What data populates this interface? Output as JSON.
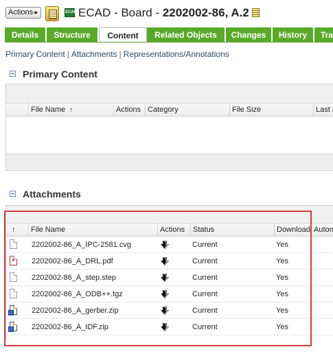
{
  "header": {
    "actions_label": "Actions",
    "ecad_badge": "ECAD",
    "title_prefix": "ECAD - Board - ",
    "title_number": "2202002-86, A.2"
  },
  "tabs": [
    {
      "label": "Details",
      "active": false
    },
    {
      "label": "Structure",
      "active": false
    },
    {
      "label": "Content",
      "active": true
    },
    {
      "label": "Related Objects",
      "active": false
    },
    {
      "label": "Changes",
      "active": false
    },
    {
      "label": "History",
      "active": false
    },
    {
      "label": "Tra",
      "active": false
    }
  ],
  "subnav": {
    "primary": "Primary Content",
    "attachments": "Attachments",
    "representations": "Representations/Annotations"
  },
  "primary_content": {
    "title": "Primary Content",
    "columns": [
      "File Name",
      "Actions",
      "Category",
      "File Size",
      "Last M"
    ],
    "sort_arrow": "↑"
  },
  "attachments": {
    "title": "Attachments",
    "sort_arrow": "↑",
    "columns": [
      "File Name",
      "Actions",
      "Status",
      "Download",
      "Autom"
    ],
    "rows": [
      {
        "icon": "generic-file-icon",
        "file_name": "2202002-86_A_IPC-2581.cvg",
        "status": "Current",
        "download": "Yes"
      },
      {
        "icon": "pdf-file-icon",
        "file_name": "2202002-86_A_DRL.pdf",
        "status": "Current",
        "download": "Yes"
      },
      {
        "icon": "generic-file-icon",
        "file_name": "2202002-86_A_step.step",
        "status": "Current",
        "download": "Yes"
      },
      {
        "icon": "generic-file-icon",
        "file_name": "2202002-86_A_ODB++.tgz",
        "status": "Current",
        "download": "Yes"
      },
      {
        "icon": "zip-file-icon",
        "file_name": "2202002-86_A_gerber.zip",
        "status": "Current",
        "download": "Yes"
      },
      {
        "icon": "zip-file-icon",
        "file_name": "2202002-86_A_IDF.zip",
        "status": "Current",
        "download": "Yes"
      }
    ]
  },
  "colors": {
    "tab_green": "#5aaa2a",
    "highlight_red": "#d83a3a",
    "link_blue": "#2a4a6a"
  }
}
